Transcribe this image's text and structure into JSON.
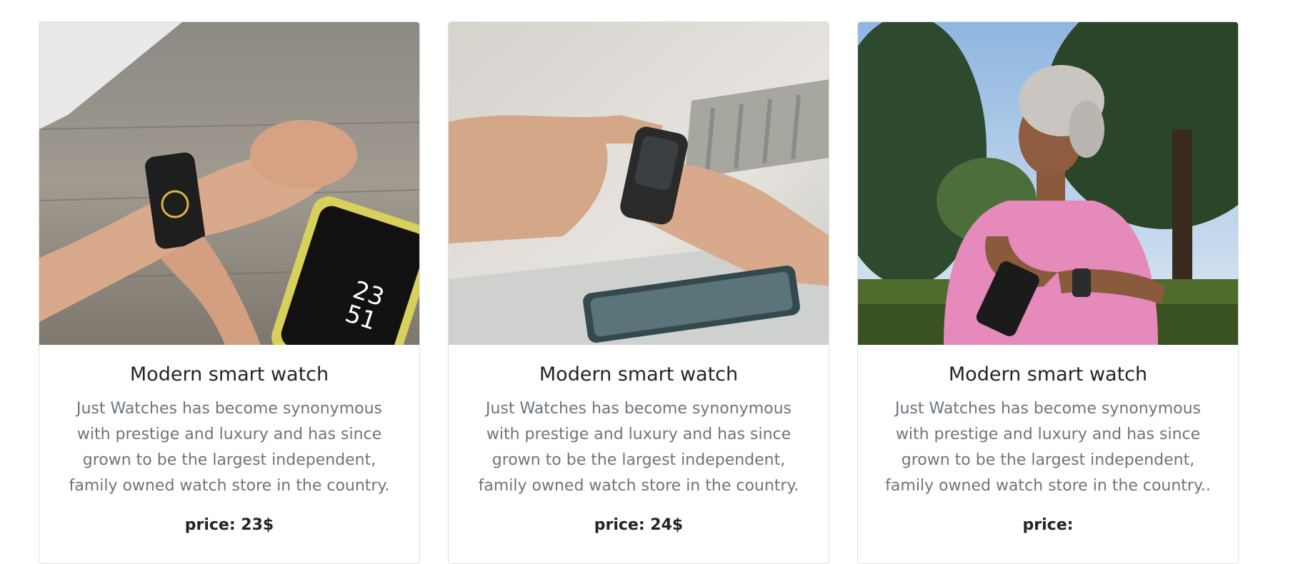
{
  "products": [
    {
      "title": "Modern smart watch",
      "description": "Just Watches has become synonymous with prestige and luxury and has since grown to be the largest independent, family owned watch store in the country.",
      "price": "price: 23$",
      "image": "hand-with-smartwatch-and-phone-on-wood-table"
    },
    {
      "title": "Modern smart watch",
      "description": "Just Watches has become synonymous with prestige and luxury and has since grown to be the largest independent, family owned watch store in the country.",
      "price": "price: 24$",
      "image": "hand-tapping-smartwatch-over-desk-with-phone"
    },
    {
      "title": "Modern smart watch",
      "description": "Just Watches has become synonymous with prestige and luxury and has since grown to be the largest independent, family owned watch store in the country..",
      "price": "price:",
      "image": "woman-in-pink-shirt-checking-smartwatch-outdoors"
    }
  ],
  "colors": {
    "title": "#212529",
    "text_muted": "#6c757d",
    "border": "#dfdfdf"
  }
}
